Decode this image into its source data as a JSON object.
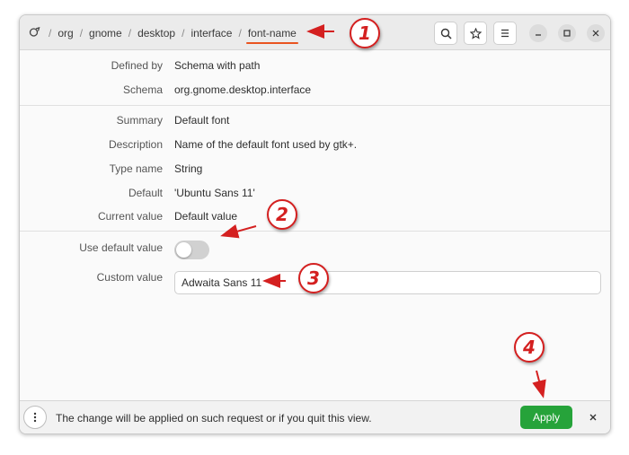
{
  "header": {
    "breadcrumbs": [
      "org",
      "gnome",
      "desktop",
      "interface",
      "font-name"
    ],
    "separator": "/",
    "buttons": [
      "search-icon",
      "star-icon",
      "hamburger-menu-icon"
    ],
    "window_controls": [
      "minimize-icon",
      "maximize-icon",
      "close-icon"
    ]
  },
  "details": {
    "defined_by_label": "Defined by",
    "defined_by_value": "Schema with path",
    "schema_label": "Schema",
    "schema_value": "org.gnome.desktop.interface",
    "summary_label": "Summary",
    "summary_value": "Default font",
    "description_label": "Description",
    "description_value": "Name of the default font used by gtk+.",
    "type_label": "Type name",
    "type_value": "String",
    "default_label": "Default",
    "default_value": "'Ubuntu Sans 11'",
    "current_label": "Current value",
    "current_value": "Default value"
  },
  "controls": {
    "use_default_label": "Use default value",
    "use_default_on": false,
    "custom_value_label": "Custom value",
    "custom_value": "Adwaita Sans 11"
  },
  "infobar": {
    "message": "The change will be applied on such request or if you quit this view.",
    "apply_label": "Apply"
  },
  "annotations": [
    "1",
    "2",
    "3",
    "4"
  ],
  "colors": {
    "accent_underline": "#e95420",
    "apply_button": "#26a33a",
    "annotation": "#d42020"
  }
}
